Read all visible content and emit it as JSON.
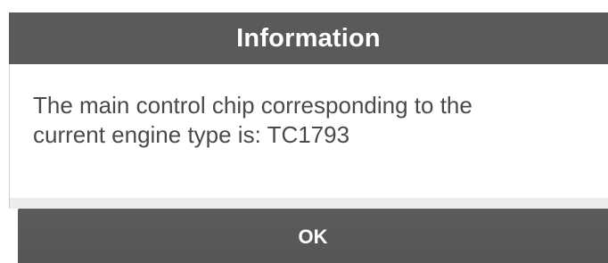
{
  "dialog": {
    "title": "Information",
    "message_line_1": "The main control chip corresponding to the",
    "message_line_2": "current engine type is: TC1793",
    "ok_label": "OK"
  },
  "colors": {
    "title_bar": "#5a5a5a",
    "button": "#585858",
    "message_text": "#4a4a4a",
    "background": "#ffffff"
  }
}
